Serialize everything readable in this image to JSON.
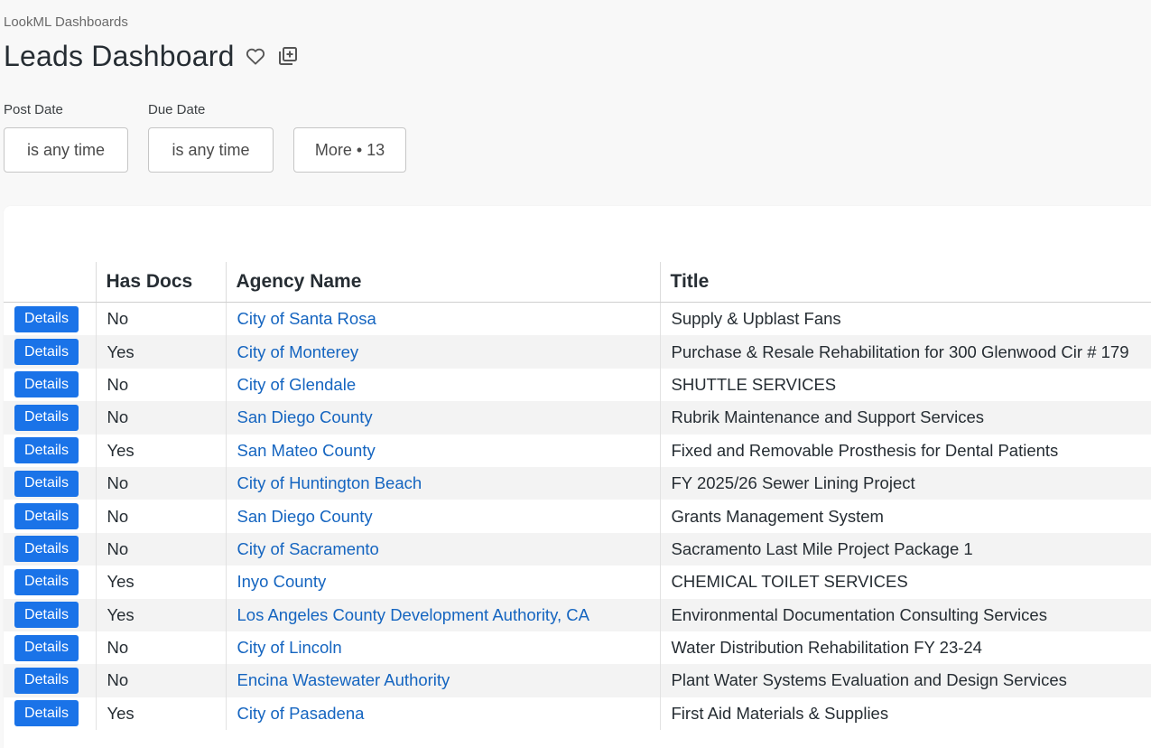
{
  "breadcrumb": "LookML Dashboards",
  "page_title": "Leads Dashboard",
  "filters": [
    {
      "label": "Post Date",
      "value": "is any time"
    },
    {
      "label": "Due Date",
      "value": "is any time"
    }
  ],
  "more_filters": "More • 13",
  "table": {
    "headers": [
      "",
      "Has Docs",
      "Agency Name",
      "Title"
    ],
    "details_label": "Details",
    "rows": [
      {
        "has_docs": "No",
        "agency": "City of Santa Rosa",
        "title": "Supply & Upblast Fans"
      },
      {
        "has_docs": "Yes",
        "agency": "City of Monterey",
        "title": "Purchase & Resale Rehabilitation for 300 Glenwood Cir # 179"
      },
      {
        "has_docs": "No",
        "agency": "City of Glendale",
        "title": "SHUTTLE SERVICES"
      },
      {
        "has_docs": "No",
        "agency": "San Diego County",
        "title": "Rubrik Maintenance and Support Services"
      },
      {
        "has_docs": "Yes",
        "agency": "San Mateo County",
        "title": "Fixed and Removable Prosthesis for Dental Patients"
      },
      {
        "has_docs": "No",
        "agency": "City of Huntington Beach",
        "title": "FY 2025/26 Sewer Lining Project"
      },
      {
        "has_docs": "No",
        "agency": "San Diego County",
        "title": "Grants Management System"
      },
      {
        "has_docs": "No",
        "agency": "City of Sacramento",
        "title": "Sacramento Last Mile Project Package 1"
      },
      {
        "has_docs": "Yes",
        "agency": "Inyo County",
        "title": "CHEMICAL TOILET SERVICES"
      },
      {
        "has_docs": "Yes",
        "agency": "Los Angeles County Development Authority, CA",
        "title": "Environmental Documentation Consulting Services"
      },
      {
        "has_docs": "No",
        "agency": "City of Lincoln",
        "title": "Water Distribution Rehabilitation FY 23-24"
      },
      {
        "has_docs": "No",
        "agency": "Encina Wastewater Authority",
        "title": "Plant Water Systems Evaluation and Design Services"
      },
      {
        "has_docs": "Yes",
        "agency": "City of Pasadena",
        "title": "First Aid Materials & Supplies"
      }
    ]
  },
  "colors": {
    "accent": "#1a73e8",
    "link": "#1565c0",
    "row_alt": "#f3f3f3"
  },
  "icons": [
    "heart-icon",
    "add-to-board-icon"
  ]
}
